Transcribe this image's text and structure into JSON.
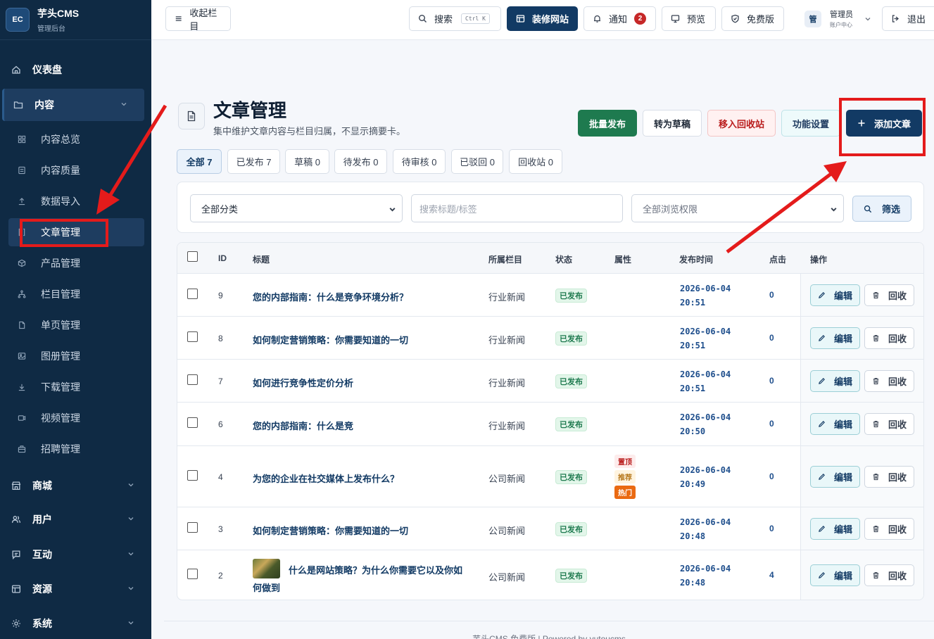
{
  "brand": {
    "logo": "EC",
    "name": "芋头CMS",
    "sub": "管理后台"
  },
  "sidebar": {
    "dashboard": "仪表盘",
    "content": "内容",
    "sub": [
      {
        "label": "内容总览",
        "icon": "grid-icon"
      },
      {
        "label": "内容质量",
        "icon": "check-doc-icon"
      },
      {
        "label": "数据导入",
        "icon": "upload-icon"
      },
      {
        "label": "文章管理",
        "icon": "bracket-icon"
      },
      {
        "label": "产品管理",
        "icon": "box-icon"
      },
      {
        "label": "栏目管理",
        "icon": "tree-icon"
      },
      {
        "label": "单页管理",
        "icon": "file-icon"
      },
      {
        "label": "图册管理",
        "icon": "image-icon"
      },
      {
        "label": "下载管理",
        "icon": "download-icon"
      },
      {
        "label": "视频管理",
        "icon": "video-icon"
      },
      {
        "label": "招聘管理",
        "icon": "briefcase-icon"
      }
    ],
    "groups": [
      {
        "label": "商城",
        "icon": "store-icon"
      },
      {
        "label": "用户",
        "icon": "users-icon"
      },
      {
        "label": "互动",
        "icon": "chat-icon"
      },
      {
        "label": "资源",
        "icon": "layout-icon"
      },
      {
        "label": "系统",
        "icon": "settings-icon"
      }
    ]
  },
  "topbar": {
    "collapse": "收起栏目",
    "search": "搜索",
    "search_kbd": "Ctrl K",
    "decorate": "装修网站",
    "notify": "通知",
    "notify_count": "2",
    "preview": "预览",
    "edition": "免费版",
    "user_avatar": "管",
    "user_name": "管理员",
    "user_sub": "账户中心",
    "logout": "退出"
  },
  "page": {
    "title": "文章管理",
    "desc": "集中维护文章内容与栏目归属，不显示摘要卡。",
    "actions": {
      "batch_publish": "批量发布",
      "to_draft": "转为草稿",
      "to_recycle": "移入回收站",
      "settings": "功能设置",
      "add": "添加文章"
    }
  },
  "tabs": [
    "全部 7",
    "已发布 7",
    "草稿 0",
    "待发布 0",
    "待审核 0",
    "已驳回 0",
    "回收站 0"
  ],
  "filters": {
    "category": "全部分类",
    "search_placeholder": "搜索标题/标签",
    "access": "全部浏览权限",
    "filter_btn": "筛选"
  },
  "table": {
    "headers": {
      "id": "ID",
      "title": "标题",
      "category": "所属栏目",
      "status": "状态",
      "attr": "属性",
      "date": "发布时间",
      "clicks": "点击",
      "ops": "操作"
    },
    "edit": "编辑",
    "recycle": "回收",
    "rows": [
      {
        "id": "9",
        "title": "您的内部指南：什么是竞争环境分析？",
        "category": "行业新闻",
        "status": "已发布",
        "date1": "2026-06-04",
        "date2": "20:51",
        "clicks": "0"
      },
      {
        "id": "8",
        "title": "如何制定营销策略：你需要知道的一切",
        "category": "行业新闻",
        "status": "已发布",
        "date1": "2026-06-04",
        "date2": "20:51",
        "clicks": "0"
      },
      {
        "id": "7",
        "title": "如何进行竞争性定价分析",
        "category": "行业新闻",
        "status": "已发布",
        "date1": "2026-06-04",
        "date2": "20:51",
        "clicks": "0"
      },
      {
        "id": "6",
        "title": "您的内部指南：什么是竞",
        "category": "行业新闻",
        "status": "已发布",
        "date1": "2026-06-04",
        "date2": "20:50",
        "clicks": "0"
      },
      {
        "id": "4",
        "title": "为您的企业在社交媒体上发布什么？",
        "category": "公司新闻",
        "status": "已发布",
        "date1": "2026-06-04",
        "date2": "20:49",
        "clicks": "0",
        "attrs": [
          "置顶",
          "推荐",
          "热门"
        ]
      },
      {
        "id": "3",
        "title": "如何制定营销策略：你需要知道的一切",
        "category": "公司新闻",
        "status": "已发布",
        "date1": "2026-06-04",
        "date2": "20:48",
        "clicks": "0"
      },
      {
        "id": "2",
        "title_line1": "什么是网站策略？为什么你需要它以及你如",
        "title_line2": "何做到",
        "category": "公司新闻",
        "status": "已发布",
        "date1": "2026-06-04",
        "date2": "20:48",
        "clicks": "4"
      }
    ]
  },
  "footer": "芋头CMS 免费版 | Powered by yutoucms",
  "colors": {
    "sidebar": "#0f2a44",
    "primary": "#123a64",
    "green": "#1e7a4f",
    "annotation": "#e41b1b"
  }
}
